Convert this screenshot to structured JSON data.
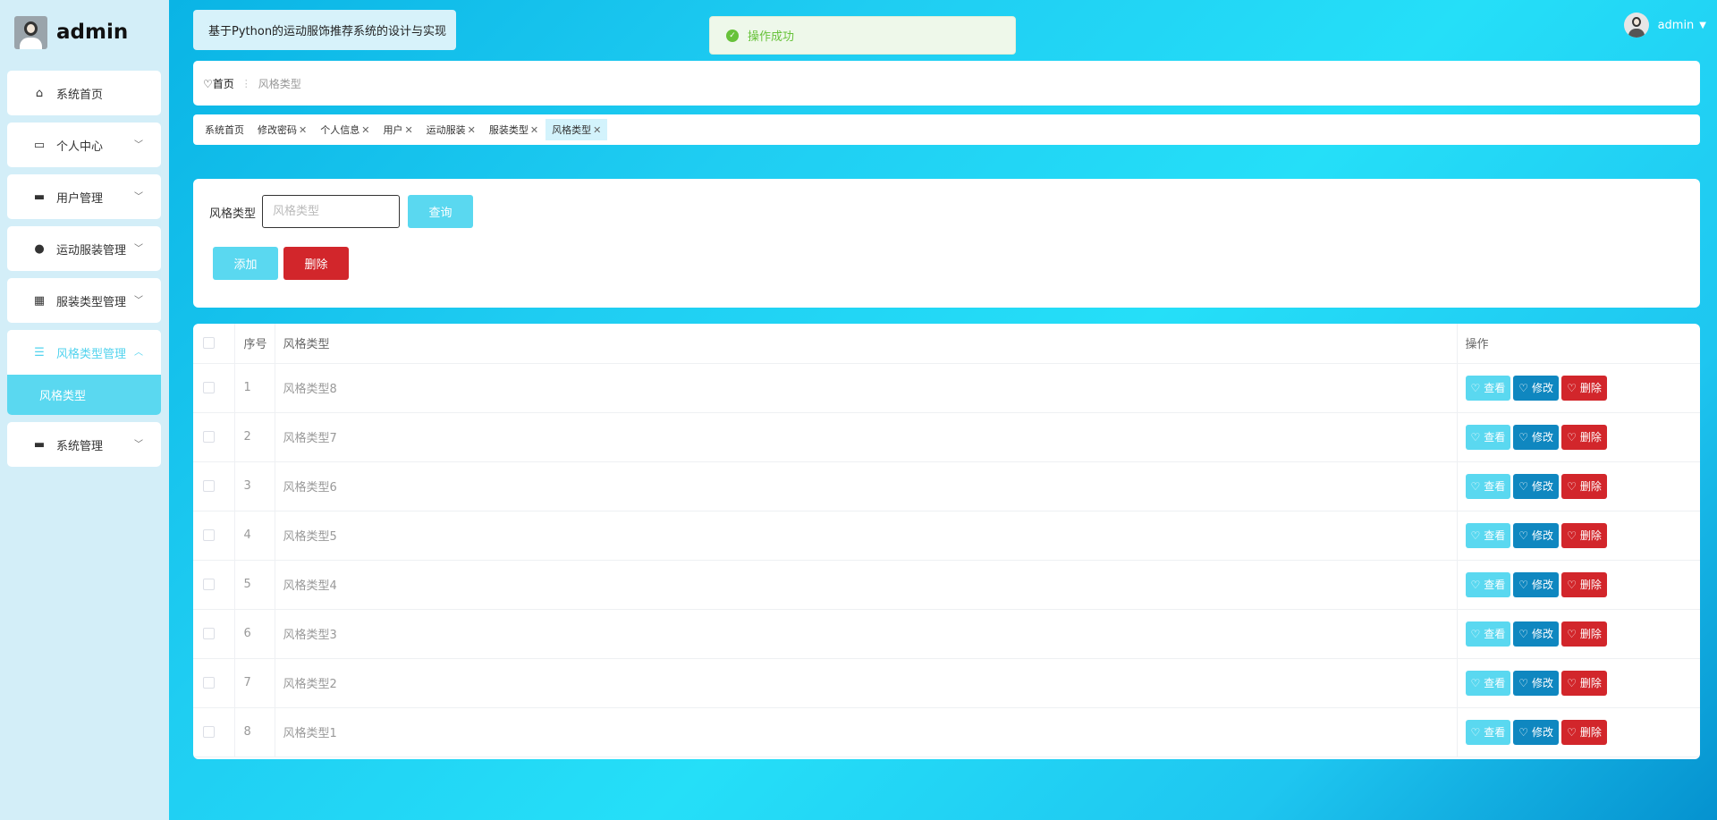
{
  "brand": {
    "name": "admin"
  },
  "sidebar": {
    "items": [
      {
        "label": "系统首页",
        "icon": "home-icon"
      },
      {
        "label": "个人中心",
        "icon": "wallet-icon"
      },
      {
        "label": "用户管理",
        "icon": "monitor-icon"
      },
      {
        "label": "运动服装管理",
        "icon": "user-icon"
      },
      {
        "label": "服装类型管理",
        "icon": "grid-icon"
      },
      {
        "label": "风格类型管理",
        "icon": "list-icon",
        "sub": "风格类型"
      },
      {
        "label": "系统管理",
        "icon": "printer-icon"
      }
    ]
  },
  "header": {
    "title": "基于Python的运动服饰推荐系统的设计与实现",
    "toast": "操作成功",
    "user": "admin"
  },
  "breadcrumb": {
    "home": "首页",
    "sep": "⋮",
    "current": "风格类型"
  },
  "tags": [
    "系统首页",
    "修改密码",
    "个人信息",
    "用户",
    "运动服装",
    "服装类型",
    "风格类型"
  ],
  "search": {
    "label": "风格类型",
    "placeholder": "风格类型",
    "query_label": "查询",
    "add_label": "添加",
    "delete_label": "删除"
  },
  "table": {
    "headers": {
      "index": "序号",
      "name": "风格类型",
      "ops": "操作"
    },
    "rows": [
      {
        "index": "1",
        "name": "风格类型8"
      },
      {
        "index": "2",
        "name": "风格类型7"
      },
      {
        "index": "3",
        "name": "风格类型6"
      },
      {
        "index": "4",
        "name": "风格类型5"
      },
      {
        "index": "5",
        "name": "风格类型4"
      },
      {
        "index": "6",
        "name": "风格类型3"
      },
      {
        "index": "7",
        "name": "风格类型2"
      },
      {
        "index": "8",
        "name": "风格类型1"
      }
    ],
    "ops": {
      "view": "查看",
      "edit": "修改",
      "del": "删除"
    }
  },
  "colors": {
    "accent": "#5ad8f0",
    "edit": "#0f87c0",
    "danger": "#d2262b",
    "success": "#67c23a"
  }
}
